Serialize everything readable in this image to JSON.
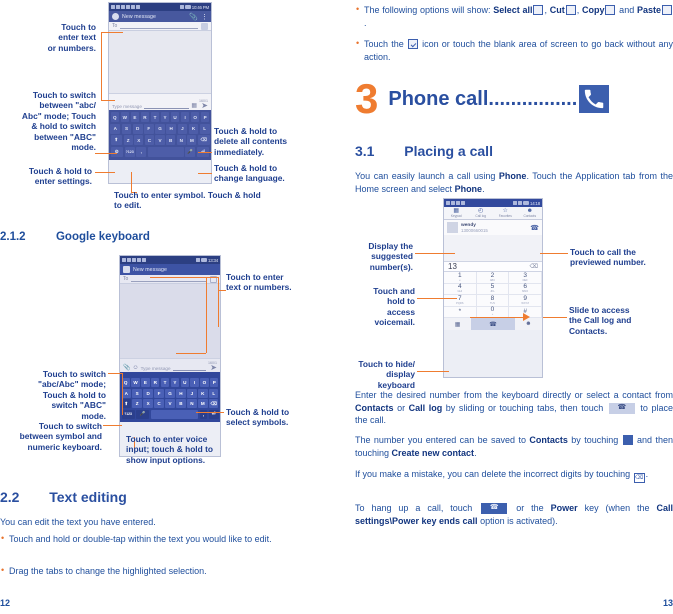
{
  "left_page": {
    "page_number": "12",
    "section_2_1_2": {
      "number": "2.1.2",
      "title": "Google keyboard"
    },
    "section_2_2": {
      "number": "2.2",
      "title": "Text editing"
    },
    "intro_2_2": "You can edit the text you have entered.",
    "bullets_2_2": [
      "Touch and hold or double-tap within the text you would like to edit.",
      "Drag the tabs to change the highlighted selection."
    ],
    "annotations_kb1": {
      "enter_text": "Touch to\nenter text\nor numbers.",
      "switch_abc": "Touch to switch\nbetween \"abc/\nAbc\" mode; Touch\n& hold to switch\nbetween \"ABC\"\nmode.",
      "settings": "Touch & hold to\nenter settings.",
      "delete_all": "Touch & hold to\ndelete all contents\nimmediately.",
      "change_language": "Touch & hold to\nchange language.",
      "symbol": "Touch to enter symbol. Touch & hold\nto edit."
    },
    "annotations_kb2": {
      "enter_text": "Touch to enter\ntext or numbers.",
      "switch_abc": "Touch to switch\n\"abc/Abc\" mode;\nTouch & hold to\nswitch \"ABC\"\nmode.",
      "switch_symbol": "Touch to switch\nbetween symbol and\nnumeric keyboard.",
      "select_symbols": "Touch & hold to\nselect symbols.",
      "voice_input": "Touch to enter voice\ninput; touch & hold to\nshow input options."
    },
    "phone_sms_1": {
      "status_time": "10:46 PM",
      "app_title": "New message",
      "to_label": "To",
      "compose_placeholder": "Type message",
      "char_counter": "160/1",
      "keyboard_rows": [
        [
          "Q",
          "W",
          "E",
          "R",
          "T",
          "Y",
          "U",
          "I",
          "O",
          "P"
        ],
        [
          "A",
          "S",
          "D",
          "F",
          "G",
          "H",
          "J",
          "K",
          "L"
        ],
        [
          "⇧",
          "Z",
          "X",
          "C",
          "V",
          "B",
          "N",
          "M",
          "⌫"
        ],
        [
          "☺",
          "?123",
          ",",
          "",
          "•",
          "⏎"
        ]
      ]
    },
    "phone_sms_2": {
      "status_time": "13:34",
      "app_title": "New message",
      "to_label": "To",
      "compose_placeholder": "Type message",
      "char_counter": "160/1",
      "keyboard_rows": [
        [
          "Q",
          "W",
          "E",
          "R",
          "T",
          "Y",
          "U",
          "I",
          "O",
          "P"
        ],
        [
          "A",
          "S",
          "D",
          "F",
          "G",
          "H",
          "J",
          "K",
          "L"
        ],
        [
          "⇧",
          "Z",
          "X",
          "C",
          "V",
          "B",
          "N",
          "M",
          "⌫"
        ],
        [
          "?123",
          "•",
          "",
          ",",
          "⏎"
        ]
      ]
    }
  },
  "right_page": {
    "page_number": "13",
    "top_bullets": [
      {
        "prefix": "The following options will show: ",
        "b1": "Select all",
        "mid1": ", ",
        "b2": "Cut",
        "mid2": ", ",
        "b3": "Copy",
        "mid3": " and ",
        "b4": "Paste",
        "suffix": "."
      },
      {
        "prefix": "Touch the ",
        "mid": " icon or touch the blank area of screen to go back without any action."
      }
    ],
    "chapter": {
      "number": "3",
      "title": "Phone call",
      "dots": "................"
    },
    "section_3_1": {
      "number": "3.1",
      "title": "Placing a call"
    },
    "para_3_1": "You can easily launch a call using Phone. Touch the Application tab from the Home screen and select Phone.",
    "annotations_dialer": {
      "display_suggested": "Display the\nsuggested\nnumber(s).",
      "call_previewed": "Touch to call the\npreviewed number.",
      "voicemail": "Touch and hold to\naccess voicemail.",
      "slide_access": "Slide to access\nthe Call log and\nContacts.",
      "hide_keyboard": "Touch to hide/\ndisplay keyboard"
    },
    "phone_dialer": {
      "status_time": "14:18",
      "tabs": [
        {
          "label": "Keypad",
          "icon": "keypad-icon"
        },
        {
          "label": "Call log",
          "icon": "clock-icon"
        },
        {
          "label": "Favorites",
          "icon": "star-icon"
        },
        {
          "label": "Contacts",
          "icon": "contacts-icon"
        }
      ],
      "suggestion": {
        "name": "wendy",
        "number": "13000660015"
      },
      "entered_number": "13",
      "keys": [
        {
          "digit": "1",
          "sub": "∞"
        },
        {
          "digit": "2",
          "sub": "ABC"
        },
        {
          "digit": "3",
          "sub": "DEF"
        },
        {
          "digit": "4",
          "sub": "GHI"
        },
        {
          "digit": "5",
          "sub": "JKL"
        },
        {
          "digit": "6",
          "sub": "MNO"
        },
        {
          "digit": "7",
          "sub": "PQRS"
        },
        {
          "digit": "8",
          "sub": "TUV"
        },
        {
          "digit": "9",
          "sub": "WXYZ"
        },
        {
          "digit": "*",
          "sub": ""
        },
        {
          "digit": "0",
          "sub": "+"
        },
        {
          "digit": "#",
          "sub": ""
        }
      ]
    },
    "paragraphs": [
      "Enter the desired number from the keyboard directly or select a contact from Contacts or Call log by sliding or touching tabs, then touch [call] to place the call.",
      "The number you entered can be saved to Contacts by touching [addcontact] and then touching Create new contact.",
      "If you make a mistake, you can delete the incorrect digits by touching [delete] .",
      "To hang up a call, touch [hangup] or the Power key (when the Call settings\\Power key ends call option is activated)."
    ],
    "para_tokens": {
      "p1_a": "Enter the desired number from the keyboard directly or select a contact from ",
      "p1_b1": "Contacts",
      "p1_b": " or ",
      "p1_b2": "Call log",
      "p1_c": " by sliding or touching tabs, then touch ",
      "p1_d": " to place the call.",
      "p2_a": "The number you entered can be saved to ",
      "p2_b1": "Contacts",
      "p2_b": " by touching ",
      "p2_c": " and then touching ",
      "p2_b2": "Create new contact",
      "p2_d": ".",
      "p3_a": "If you make a mistake, you can delete the incorrect digits by touching ",
      "p3_b": ".",
      "p4_a": "To hang up a call, touch ",
      "p4_b": " or the ",
      "p4_b1": "Power",
      "p4_c": " key (when the ",
      "p4_b2": "Call settings\\Power key ends call",
      "p4_d": " option is activated)."
    }
  },
  "colors": {
    "accent_orange": "#ef7c30",
    "text_blue": "#1f4e9c",
    "heading_blue": "#2a4fa0",
    "phone_chrome": "#47589e"
  }
}
